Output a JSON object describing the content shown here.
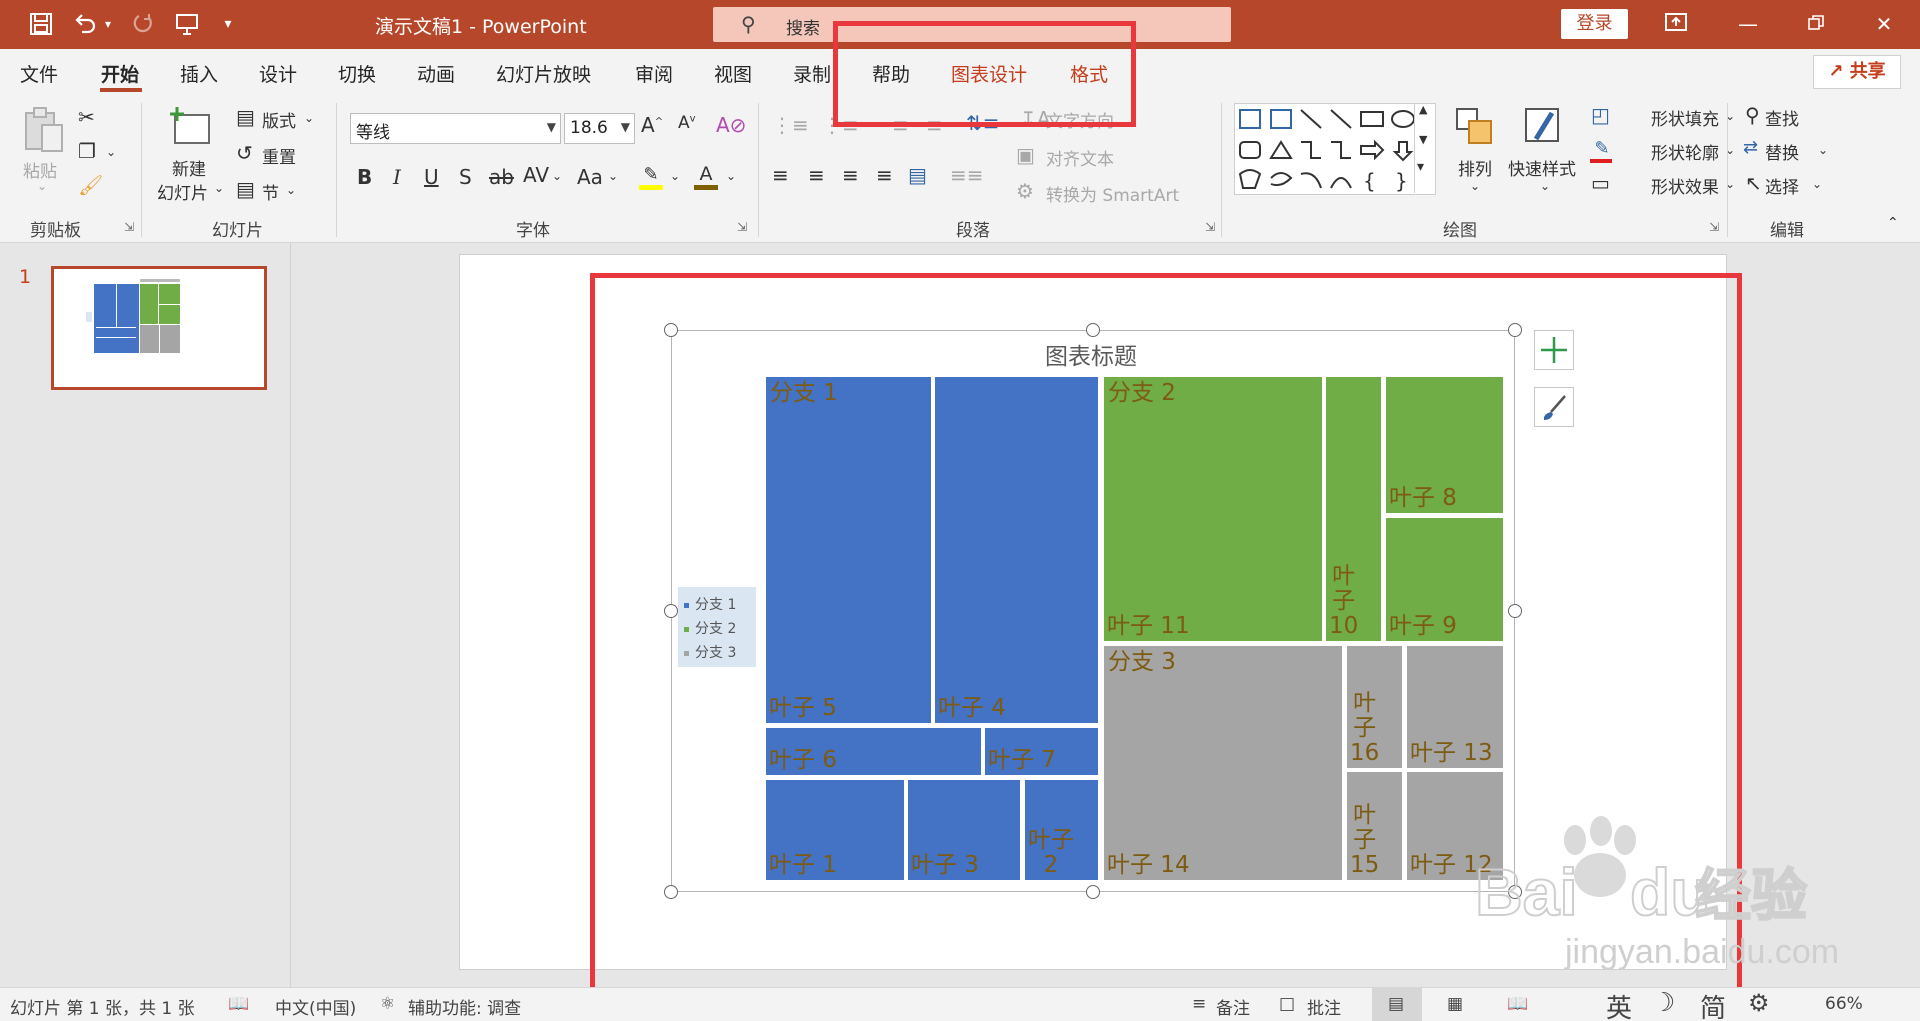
{
  "titlebar": {
    "doc_title": "演示文稿1 - PowerPoint",
    "search_placeholder": "搜索",
    "login": "登录",
    "accent_color": "#b7472a"
  },
  "tabs": {
    "file": "文件",
    "home": "开始",
    "insert": "插入",
    "design": "设计",
    "transitions": "切换",
    "animations": "动画",
    "slideshow": "幻灯片放映",
    "review": "审阅",
    "view": "视图",
    "record": "录制",
    "help": "帮助",
    "chart_design": "图表设计",
    "format": "格式",
    "share": "共享"
  },
  "ribbon": {
    "clipboard": {
      "paste": "粘贴",
      "group": "剪贴板"
    },
    "slides": {
      "new_slide_1": "新建",
      "new_slide_2": "幻灯片",
      "layout": "版式",
      "reset": "重置",
      "section": "节",
      "group": "幻灯片"
    },
    "font": {
      "font_name": "等线",
      "font_size": "18.6",
      "group": "字体"
    },
    "paragraph": {
      "text_direction": "文字方向",
      "align_text": "对齐文本",
      "smartart": "转换为 SmartArt",
      "group": "段落"
    },
    "drawing": {
      "arrange": "排列",
      "quick_styles": "快速样式",
      "shape_fill": "形状填充",
      "shape_outline": "形状轮廓",
      "shape_effects": "形状效果",
      "group": "绘图"
    },
    "editing": {
      "find": "查找",
      "replace": "替换",
      "select": "选择",
      "group": "编辑"
    }
  },
  "left_pane": {
    "slide_number": "1"
  },
  "chart": {
    "title": "图表标题",
    "branch_colors": {
      "branch1": "#4472c4",
      "branch2": "#70ad47",
      "branch3": "#a5a5a5"
    },
    "label_color": "#7d5b12",
    "legend": [
      "分支 1",
      "分支 2",
      "分支 3"
    ],
    "labels": {
      "branch1": "分支 1",
      "branch2": "分支 2",
      "branch3": "分支 3",
      "leaf5": "叶子 5",
      "leaf4": "叶子 4",
      "leaf6": "叶子 6",
      "leaf7": "叶子 7",
      "leaf1": "叶子 1",
      "leaf3": "叶子 3",
      "leaf2": "叶子\n2",
      "leaf11": "叶子 11",
      "leaf10": "叶\n子\n10",
      "leaf8": "叶子 8",
      "leaf9": "叶子 9",
      "leaf14": "叶子 14",
      "leaf16": "叶\n子\n16",
      "leaf13": "叶子 13",
      "leaf15": "叶\n子\n15",
      "leaf12": "叶子 12"
    }
  },
  "statusbar": {
    "slide_info": "幻灯片 第 1 张，共 1 张",
    "language": "中文(中国)",
    "accessibility": "辅助功能: 调查",
    "notes": "备注",
    "comments": "批注",
    "ime_lang": "英",
    "ime_simplified": "简",
    "zoom": "66%"
  },
  "watermark": {
    "text1": "Bai",
    "text2": "du",
    "text3": "经验",
    "url": "jingyan.baidu.com"
  }
}
